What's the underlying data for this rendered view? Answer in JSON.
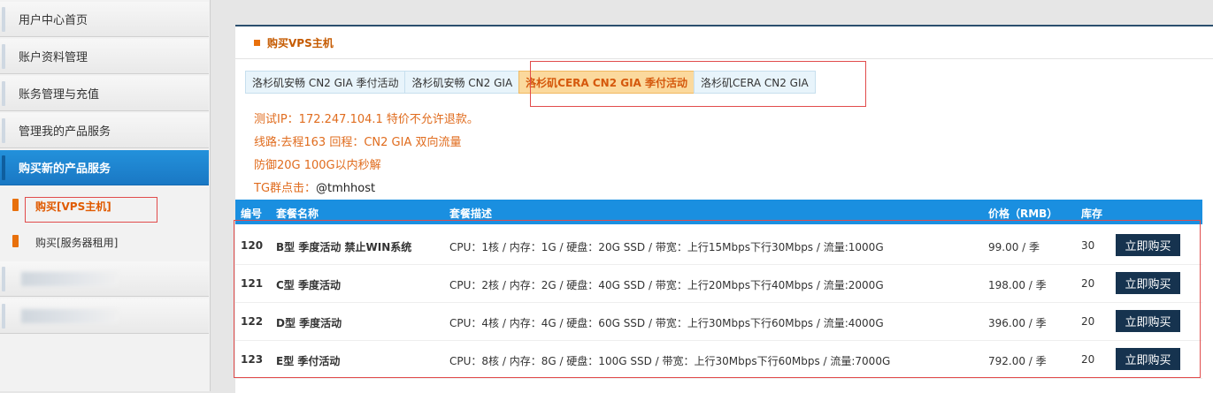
{
  "sidebar": {
    "items": [
      {
        "label": "用户中心首页"
      },
      {
        "label": "账户资料管理"
      },
      {
        "label": "账务管理与充值"
      },
      {
        "label": "管理我的产品服务"
      },
      {
        "label": "购买新的产品服务"
      }
    ],
    "sub_items": [
      {
        "label": "购买[VPS主机]"
      },
      {
        "label": "购买[服务器租用]"
      }
    ]
  },
  "panel": {
    "title": "购买VPS主机",
    "tabs": [
      {
        "label": "洛杉矶安畅 CN2 GIA 季付活动"
      },
      {
        "label": "洛杉矶安畅 CN2 GIA"
      },
      {
        "label": "洛杉矶CERA CN2 GIA 季付活动"
      },
      {
        "label": "洛杉矶CERA CN2 GIA"
      }
    ],
    "info": {
      "line1": "测试IP：172.247.104.1 特价不允许退款。",
      "line2": "线路:去程163 回程：CN2 GIA 双向流量",
      "line3": "防御20G 100G以内秒解",
      "tg_label": "TG群点击：",
      "tg_handle": "@tmhhost"
    }
  },
  "table": {
    "headers": {
      "id": "编号",
      "name": "套餐名称",
      "desc": "套餐描述",
      "price": "价格（RMB）",
      "stock": "库存"
    },
    "buy_label": "立即购买",
    "rows": [
      {
        "id": "120",
        "name": "B型 季度活动 禁止WIN系统",
        "desc": "CPU：1核 / 内存：1G / 硬盘：20G SSD / 带宽：上行15Mbps下行30Mbps / 流量:1000G",
        "price": "99.00 / 季",
        "stock": "30"
      },
      {
        "id": "121",
        "name": "C型 季度活动",
        "desc": "CPU：2核 / 内存：2G / 硬盘：40G SSD / 带宽：上行20Mbps下行40Mbps / 流量:2000G",
        "price": "198.00 / 季",
        "stock": "20"
      },
      {
        "id": "122",
        "name": "D型 季度活动",
        "desc": "CPU：4核 / 内存：4G / 硬盘：60G SSD / 带宽：上行30Mbps下行60Mbps / 流量:4000G",
        "price": "396.00 / 季",
        "stock": "20"
      },
      {
        "id": "123",
        "name": "E型 季付活动",
        "desc": "CPU：8核 / 内存：8G / 硬盘：100G SSD / 带宽：上行30Mbps下行60Mbps / 流量:7000G",
        "price": "792.00 / 季",
        "stock": "20"
      }
    ]
  },
  "colors": {
    "accent_blue": "#1a8fe0",
    "accent_orange": "#e8700c",
    "annotation_red": "#e14b4b"
  }
}
